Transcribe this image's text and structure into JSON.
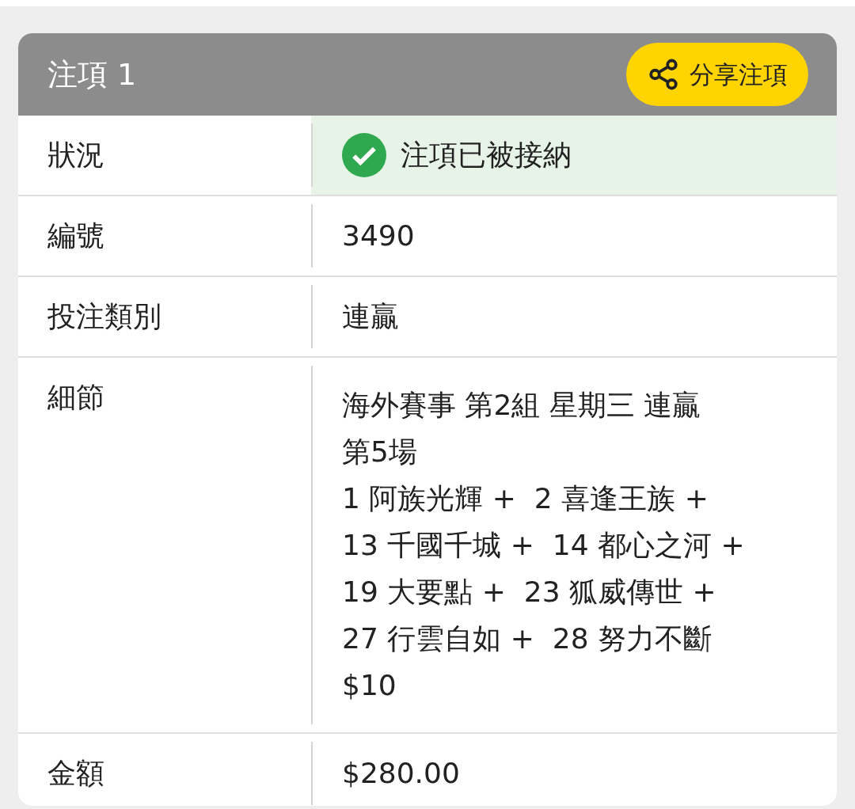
{
  "card": {
    "title": "注項 1",
    "share_button": "分享注項"
  },
  "rows": [
    {
      "label": "狀況",
      "kind": "status",
      "value": "注項已被接納",
      "accepted": true
    },
    {
      "label": "編號",
      "kind": "text",
      "value": "3490"
    },
    {
      "label": "投注類別",
      "kind": "text",
      "value": "連贏"
    },
    {
      "label": "細節",
      "kind": "lines",
      "lines": [
        "海外賽事 第2組 星期三 連贏",
        "第5場",
        "1 阿族光輝 +  2 喜逢王族 +",
        "13 千國千城 +  14 都心之河 +",
        "19 大要點 +  23 狐威傳世 +",
        "27 行雲自如 +  28 努力不斷",
        "$10"
      ]
    },
    {
      "label": "金額",
      "kind": "text",
      "value": "$280.00"
    }
  ]
}
